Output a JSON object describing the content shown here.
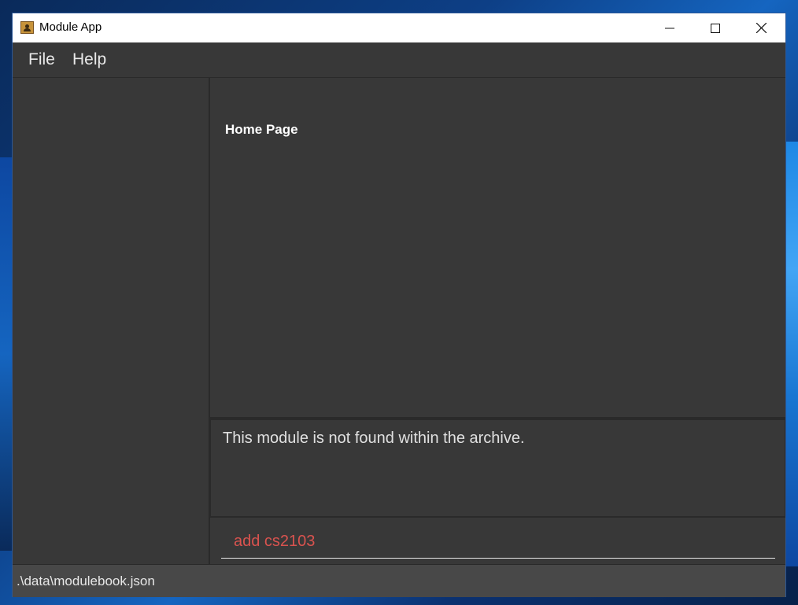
{
  "window": {
    "title": "Module App",
    "minimize_symbol": "—",
    "maximize_symbol": "☐",
    "close_symbol": "✕"
  },
  "menu": {
    "items": [
      {
        "label": "File"
      },
      {
        "label": "Help"
      }
    ]
  },
  "main": {
    "page_title": "Home Page"
  },
  "result": {
    "message": "This module is not found within the archive."
  },
  "command": {
    "value": "add cs2103"
  },
  "status": {
    "file_path": ".\\data\\modulebook.json"
  },
  "colors": {
    "background": "#383838",
    "command_text": "#d9534f",
    "titlebar": "#ffffff"
  },
  "icons": {
    "app": "app-person-icon",
    "minimize": "minimize-icon",
    "maximize": "maximize-icon",
    "close": "close-icon"
  }
}
